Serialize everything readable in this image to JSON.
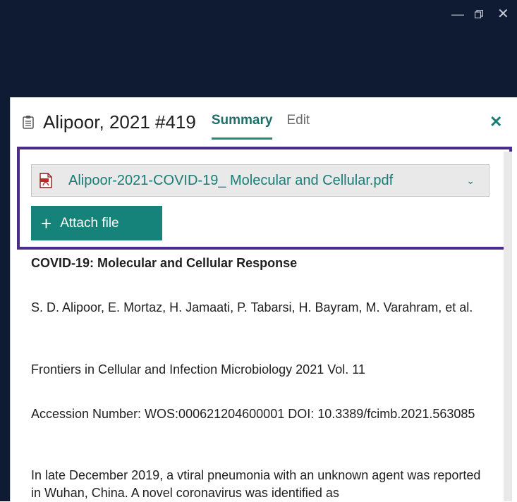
{
  "window": {
    "minimize_glyph": "—",
    "close_glyph": "✕"
  },
  "panel": {
    "reference_title": "Alipoor, 2021 #419",
    "tabs": [
      {
        "label": "Summary",
        "active": true
      },
      {
        "label": "Edit",
        "active": false
      }
    ],
    "close_glyph": "✕"
  },
  "attachment": {
    "file_name": "Alipoor-2021-COVID-19_ Molecular and Cellular.pdf",
    "dropdown_glyph": "⌄",
    "attach_label": "Attach file",
    "attach_glyph": "+"
  },
  "reference": {
    "title": "COVID-19: Molecular and Cellular Response",
    "authors": "S. D. Alipoor, E. Mortaz, H. Jamaati, P. Tabarsi, H. Bayram, M. Varahram, et al.",
    "journal": "Frontiers in Cellular and Infection Microbiology 2021 Vol. 11",
    "accession": "Accession Number: WOS:000621204600001 DOI: 10.3389/fcimb.2021.563085",
    "abstract": "In late December 2019, a vtiral pneumonia with an unknown agent was reported in Wuhan, China. A novel coronavirus was identified as"
  },
  "colors": {
    "titlebar": "#0f1b33",
    "accent": "#1a7c75",
    "button": "#16837b",
    "highlight_border": "#4a2c8a"
  },
  "icons": [
    "clipboard-icon",
    "pdf-icon",
    "chevron-down-icon",
    "plus-icon",
    "close-icon",
    "minimize-icon",
    "restore-icon"
  ]
}
